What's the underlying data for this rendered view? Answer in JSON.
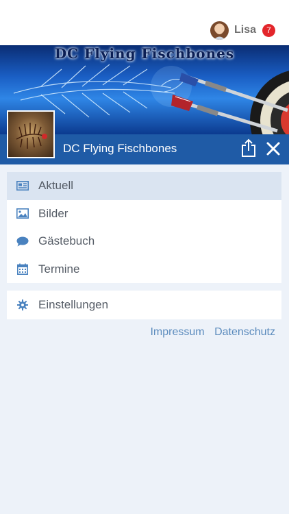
{
  "user": {
    "name": "Lisa",
    "notifications": "7"
  },
  "banner": {
    "title": "DC Flying Fischbones"
  },
  "club": {
    "name": "DC Flying Fischbones"
  },
  "menu": {
    "items": [
      {
        "label": "Aktuell",
        "icon": "newspaper-icon",
        "active": true
      },
      {
        "label": "Bilder",
        "icon": "image-icon"
      },
      {
        "label": "Gästebuch",
        "icon": "speech-bubble-icon"
      },
      {
        "label": "Termine",
        "icon": "calendar-icon"
      }
    ],
    "settings": {
      "label": "Einstellungen",
      "icon": "gear-icon"
    }
  },
  "footer": {
    "impressum": "Impressum",
    "datenschutz": "Datenschutz"
  },
  "colors": {
    "accent": "#1f5ba6",
    "badge": "#e3262b",
    "active_row": "#dae4f1",
    "icon": "#4a82bf",
    "link": "#5b8bbd"
  }
}
